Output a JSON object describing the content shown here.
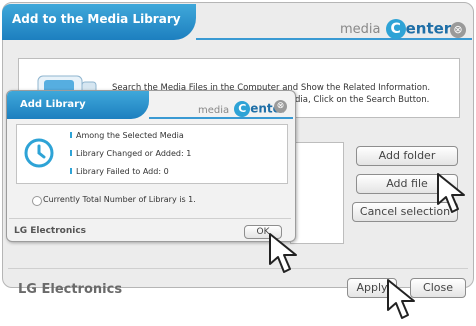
{
  "main": {
    "title": "Add to the Media Library",
    "brand_prefix": "media",
    "brand_letter": "C",
    "brand_rest": "enter",
    "close_glyph": "⊗",
    "info_line1": "Search the Media Files in the Computer and Show the Related Information.",
    "info_line2": "dia, Click on the Search Button.",
    "buttons": {
      "add_folder": "Add folder",
      "add_file": "Add file",
      "cancel_selection": "Cancel selection",
      "apply": "Apply",
      "close": "Close"
    },
    "footer_brand": "LG Electronics"
  },
  "dialog": {
    "title": "Add Library",
    "brand_prefix": "media",
    "brand_letter": "C",
    "brand_rest": "enter",
    "close_glyph": "⊗",
    "line1": "Among the Selected Media",
    "line2": "Library Changed or Added: 1",
    "line3": "Library Failed to Add: 0",
    "total_text": "Currently Total Number of Library is 1.",
    "ok_label": "OK",
    "footer_brand": "LG Electronics"
  },
  "colors": {
    "accent": "#2ea3d6",
    "title_bar": "#1d7fbf",
    "brand_text": "#1f6fa7"
  },
  "icons": {
    "close": "close-icon",
    "computer": "computer-icon",
    "clock": "clock-icon",
    "cursor": "mouse-cursor-icon"
  }
}
